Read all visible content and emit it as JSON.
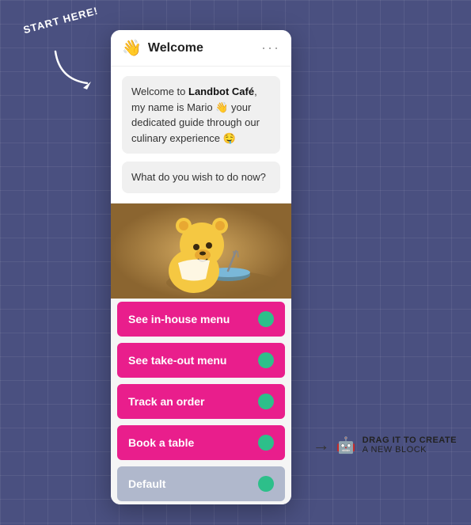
{
  "background": {
    "color": "#4a5080"
  },
  "start_here_label": "START HERE!",
  "chat_widget": {
    "header": {
      "icon": "👋",
      "title": "Welcome",
      "dots_label": "···"
    },
    "messages": [
      {
        "html": "Welcome to <strong>Landbot Café</strong>, my name is Mario 👋 your dedicated guide through our culinary experience 🤤"
      },
      {
        "text": "What do you wish to do now?"
      }
    ],
    "buttons": [
      {
        "label": "See in-house menu",
        "style": "pink"
      },
      {
        "label": "See take-out menu",
        "style": "pink"
      },
      {
        "label": "Track an order",
        "style": "pink"
      },
      {
        "label": "Book a table",
        "style": "pink"
      },
      {
        "label": "Default",
        "style": "gray"
      }
    ]
  },
  "drag_annotation": {
    "text_line1": "DRAG IT TO CREATE",
    "text_line2": "A NEW BLOCK",
    "icon": "🤖"
  }
}
